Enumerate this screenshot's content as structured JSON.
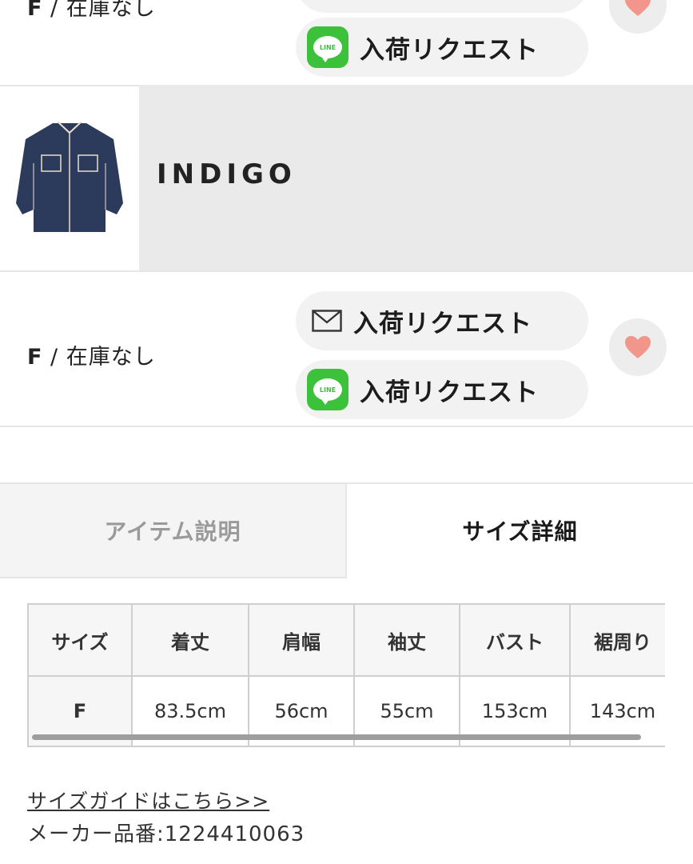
{
  "top_row": {
    "size_label": "F",
    "stock_status": "在庫なし",
    "line_request_label": "入荷リクエスト"
  },
  "color_block": {
    "color_name": "INDIGO",
    "thumbnail": "indigo-denim-shirt"
  },
  "indigo_row": {
    "size_label": "F",
    "stock_status": "在庫なし",
    "mail_request_label": "入荷リクエスト",
    "line_request_label": "入荷リクエスト"
  },
  "tabs": [
    {
      "label": "アイテム説明",
      "active": false
    },
    {
      "label": "サイズ詳細",
      "active": true
    }
  ],
  "size_table": {
    "headers": [
      "サイズ",
      "着丈",
      "肩幅",
      "袖丈",
      "バスト",
      "裾周り"
    ],
    "rows": [
      [
        "F",
        "83.5cm",
        "56cm",
        "55cm",
        "153cm",
        "143cm"
      ]
    ]
  },
  "size_guide_link": "サイズガイドはこちら>>",
  "maker_number": "メーカー品番:1224410063",
  "colors": {
    "line_green": "#3cc13a",
    "heart": "#f2958a",
    "pill_bg": "#f2f2f2",
    "tab_inactive_bg": "#f4f4f4",
    "color_name_bg": "#eaeaea"
  }
}
